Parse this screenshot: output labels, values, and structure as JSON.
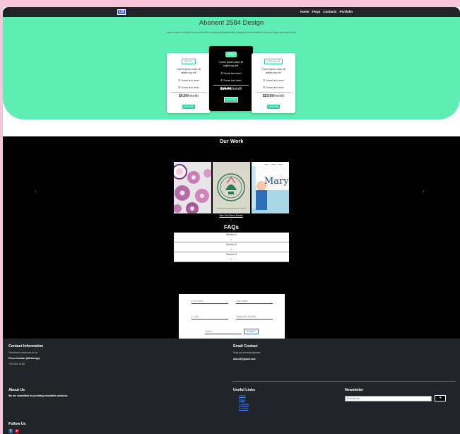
{
  "colors": {
    "accent": "#5eeeb3",
    "dark": "#212529",
    "link": "#4a8cff",
    "frame_bg": "#f7c6d9"
  },
  "navbar": {
    "logo_icon": "logo-icon",
    "logo_text": "LB",
    "links": [
      "Home",
      "FAQs",
      "Contacts",
      "Portfolio"
    ]
  },
  "hero": {
    "title": "Abonent 2584 Design",
    "subtitle": "Lorem Ipsum is simply dummy text of the printing and typesetting industry and scrambled it to make a type specimen book.",
    "plans": [
      {
        "badge": "BASIC",
        "desc": "Lorem ipsum dolor sit adipiscing elit.",
        "feature1": "☰ Some text here!",
        "feature2": "☰ Some text here!",
        "price": "$9.99",
        "per": "/month",
        "button": "CHOOSE"
      },
      {
        "badge": "PRO",
        "desc": "Lorem ipsum dolor sit adipiscing elit.",
        "feature1": "☰ Some text here!",
        "feature2": "☰ Some text here!",
        "price": "$19.99",
        "per": "/month",
        "button": "CHOOSE"
      },
      {
        "badge": "PREMIUM",
        "desc": "Lorem ipsum dolor sit adipiscing elit.",
        "feature1": "☰ Some text here!",
        "feature2": "☰ Some text here!",
        "price": "$29.99",
        "per": "/month",
        "button": "CHOOSE"
      }
    ]
  },
  "work": {
    "title": "Our Work",
    "prev_icon": "chevron-left-icon",
    "next_icon": "chevron-right-icon",
    "prev_glyph": "‹",
    "next_glyph": "›",
    "images": [
      "donuts-photo",
      "brand-logo-artwork",
      "mary-website-mockup"
    ],
    "mary_text": "Mary",
    "see_all": "See Out More Works",
    "arrow": "↓"
  },
  "faq": {
    "title": "FAQs",
    "sections": [
      "Section 1",
      "Section 2",
      "Section 3"
    ],
    "arrow": "↓"
  },
  "form": {
    "first_name": "First Name",
    "last_name": "Last Name",
    "email": "E-mail",
    "phone": "Telephone Number",
    "others": "Others",
    "submit": "SUBMIT"
  },
  "footer": {
    "contact_title": "Contact Information",
    "contact_sub": "Feel free to reach out to us.",
    "phone_label": "Phone Number (WhatsApp)",
    "phone_value": "+33 9 84 78 68",
    "email_title": "Email Contact",
    "email_sub": "Drop us an email anytime.",
    "email_value": "abc123@gmail.com",
    "about_title": "About Us",
    "about_text": "We are committed to providing innovative solutions.",
    "links_title": "Useful Links",
    "links": [
      "Home",
      "FAQs",
      "Contacts",
      "Portfolio"
    ],
    "newsletter_title": "Newsletter",
    "newsletter_placeholder": "Enter Email",
    "newsletter_button": "➔",
    "follow_title": "Follow Us",
    "social_icons": [
      "facebook-icon",
      "pinterest-icon"
    ],
    "facebook_glyph": "f",
    "pinterest_glyph": "P"
  }
}
